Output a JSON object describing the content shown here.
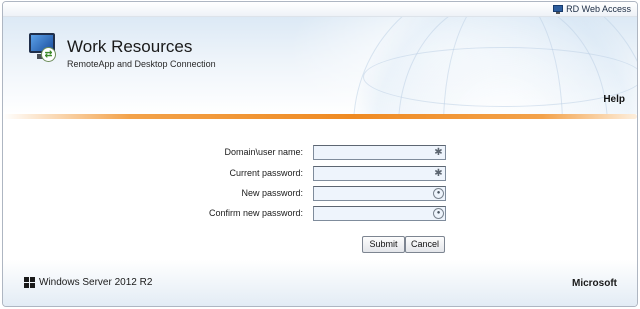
{
  "top_bar": {
    "access_label": "RD Web Access",
    "access_icon": "rd-monitor-icon"
  },
  "header": {
    "title": "Work Resources",
    "subtitle": "RemoteApp and Desktop Connection",
    "help_label": "Help",
    "app_icon": "remoteapp-monitor-icon"
  },
  "form": {
    "fields": [
      {
        "label": "Domain\\user name:",
        "value": "",
        "icon": "required-asterisk-icon"
      },
      {
        "label": "Current password:",
        "value": "",
        "icon": "required-asterisk-icon"
      },
      {
        "label": "New password:",
        "value": "",
        "icon": "password-key-icon"
      },
      {
        "label": "Confirm new password:",
        "value": "",
        "icon": "password-key-icon"
      }
    ],
    "submit_label": "Submit",
    "cancel_label": "Cancel"
  },
  "footer": {
    "os_label": "Windows Server 2012 R2",
    "brand_label": "Microsoft"
  },
  "colors": {
    "accent_orange": "#ef8a22",
    "input_bg": "#eef4fc",
    "header_blue": "#dce9f5"
  }
}
